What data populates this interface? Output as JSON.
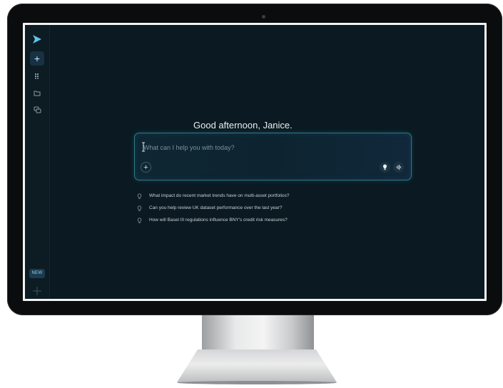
{
  "app": {
    "greeting": "Good afternoon, Janice."
  },
  "sidebar": {
    "items": [
      {
        "icon": "send-logo-icon"
      },
      {
        "icon": "plus-icon",
        "label": "+"
      },
      {
        "icon": "grid-icon"
      },
      {
        "icon": "folder-icon"
      },
      {
        "icon": "chat-bubbles-icon"
      }
    ],
    "new_badge": "NEW",
    "bottom_icon": "sparkle-icon"
  },
  "chat": {
    "placeholder": "What can I help you with today?",
    "value": "",
    "attach_label": "+",
    "icons": [
      "bulb-icon",
      "voice-wave-icon"
    ]
  },
  "suggestions": [
    "What impact do recent market trends have on multi-asset portfolios?",
    "Can you help review UK dataset performance over the last year?",
    "How will Basel III regulations influence BNY's credit risk measures?"
  ],
  "colors": {
    "screen_bg": "#0b1a22",
    "accent": "#2a7b86",
    "text": "#e8eef1",
    "muted": "#7c8f98"
  }
}
